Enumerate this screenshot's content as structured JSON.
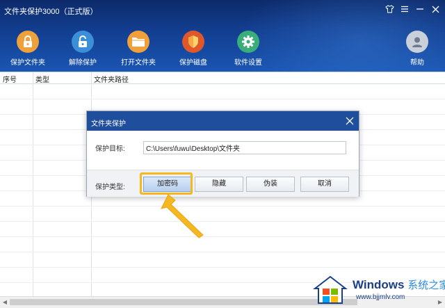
{
  "window": {
    "title": "文件夹保护3000（正式版）"
  },
  "toolbar": {
    "items": [
      {
        "label": "保护文件夹",
        "icon": "lock-icon",
        "color": "#f0a03a"
      },
      {
        "label": "解除保护",
        "icon": "unlock-icon",
        "color": "#3b8fd8"
      },
      {
        "label": "打开文件夹",
        "icon": "folder-icon",
        "color": "#f0a03a"
      },
      {
        "label": "保护磁盘",
        "icon": "shield-icon",
        "color": "#e0572a"
      },
      {
        "label": "软件设置",
        "icon": "gear-icon",
        "color": "#3aae7a"
      },
      {
        "label": "帮助",
        "icon": "user-help-icon",
        "color": "#8a96a8"
      }
    ]
  },
  "list": {
    "columns": [
      "序号",
      "类型",
      "文件夹路径"
    ]
  },
  "dialog": {
    "title": "文件夹保护",
    "target_label": "保护目标:",
    "target_value": "C:\\Users\\fuwu\\Desktop\\文件夹",
    "type_label": "保护类型:",
    "buttons": [
      "加密码",
      "隐藏",
      "伪装",
      "取消"
    ]
  },
  "watermark": {
    "brand": "Windows",
    "suffix": "系统之家",
    "url": "www.bjjmlv.com"
  },
  "colors": {
    "header_dark": "#0d2a6a",
    "header_light": "#1a56b3",
    "dialog_title": "#1f4f9c",
    "highlight": "#f5b722",
    "arrow": "#f5b722"
  }
}
